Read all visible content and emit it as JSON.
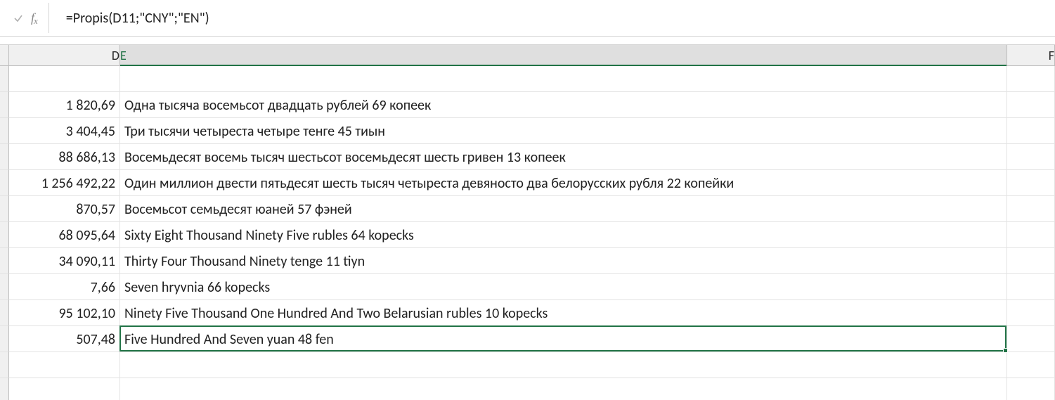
{
  "formula_bar": {
    "formula": "=Propis(D11;\"CNY\";\"EN\")"
  },
  "columns": [
    {
      "label": "D",
      "cls": "col-D",
      "selected": false
    },
    {
      "label": "E",
      "cls": "col-E",
      "selected": true
    },
    {
      "label": "F",
      "cls": "col-F",
      "selected": false
    }
  ],
  "rows": [
    {
      "D": "",
      "E": ""
    },
    {
      "D": "1 820,69",
      "E": "Одна тысяча восемьсот двадцать рублей 69 копеек"
    },
    {
      "D": "3 404,45",
      "E": "Три тысячи четыреста четыре тенге 45 тиын"
    },
    {
      "D": "88 686,13",
      "E": "Восемьдесят восемь тысяч шестьсот восемьдесят шесть гривен 13 копеек"
    },
    {
      "D": "1 256 492,22",
      "E": "Один миллион двести пятьдесят шесть тысяч четыреста девяносто два белорусских рубля 22 копейки"
    },
    {
      "D": "870,57",
      "E": "Восемьсот семьдесят юаней 57 фэней"
    },
    {
      "D": "68 095,64",
      "E": "Sixty Eight Thousand Ninety Five rubles 64 kopecks"
    },
    {
      "D": "34 090,11",
      "E": "Thirty Four Thousand Ninety tenge 11 tiyn"
    },
    {
      "D": "7,66",
      "E": "Seven hryvnia 66 kopecks"
    },
    {
      "D": "95 102,10",
      "E": "Ninety Five Thousand One Hundred And Two Belarusian rubles 10 kopecks"
    },
    {
      "D": "507,48",
      "E": "Five Hundred And Seven yuan 48 fen"
    },
    {
      "D": "",
      "E": ""
    },
    {
      "D": "",
      "E": ""
    }
  ],
  "selection": {
    "row_index": 10,
    "col": "E"
  }
}
